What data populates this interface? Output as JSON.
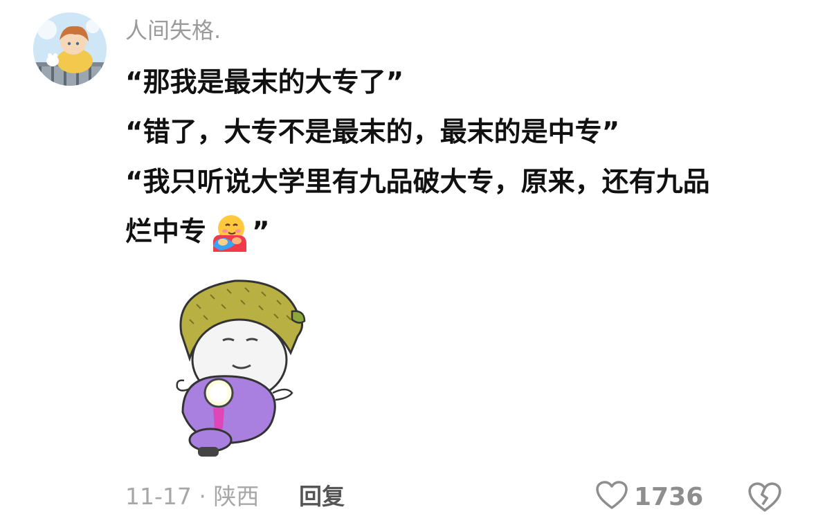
{
  "comment": {
    "username": "人间失格.",
    "lines": [
      "“那我是最末的大专了”",
      "“错了，大专不是最末的，最末的是中专”",
      "“我只听说大学里有九品破大专，原来，还有九品",
      "烂中专",
      "”"
    ],
    "emoji_icon": "hugging-face-icon",
    "sticker_icon": "durian-head-scooter-sticker"
  },
  "footer": {
    "date_location": "11-17 · 陕西",
    "reply_label": "回复",
    "like_count": "1736",
    "like_icon": "heart-outline-icon",
    "dislike_icon": "broken-heart-icon"
  }
}
